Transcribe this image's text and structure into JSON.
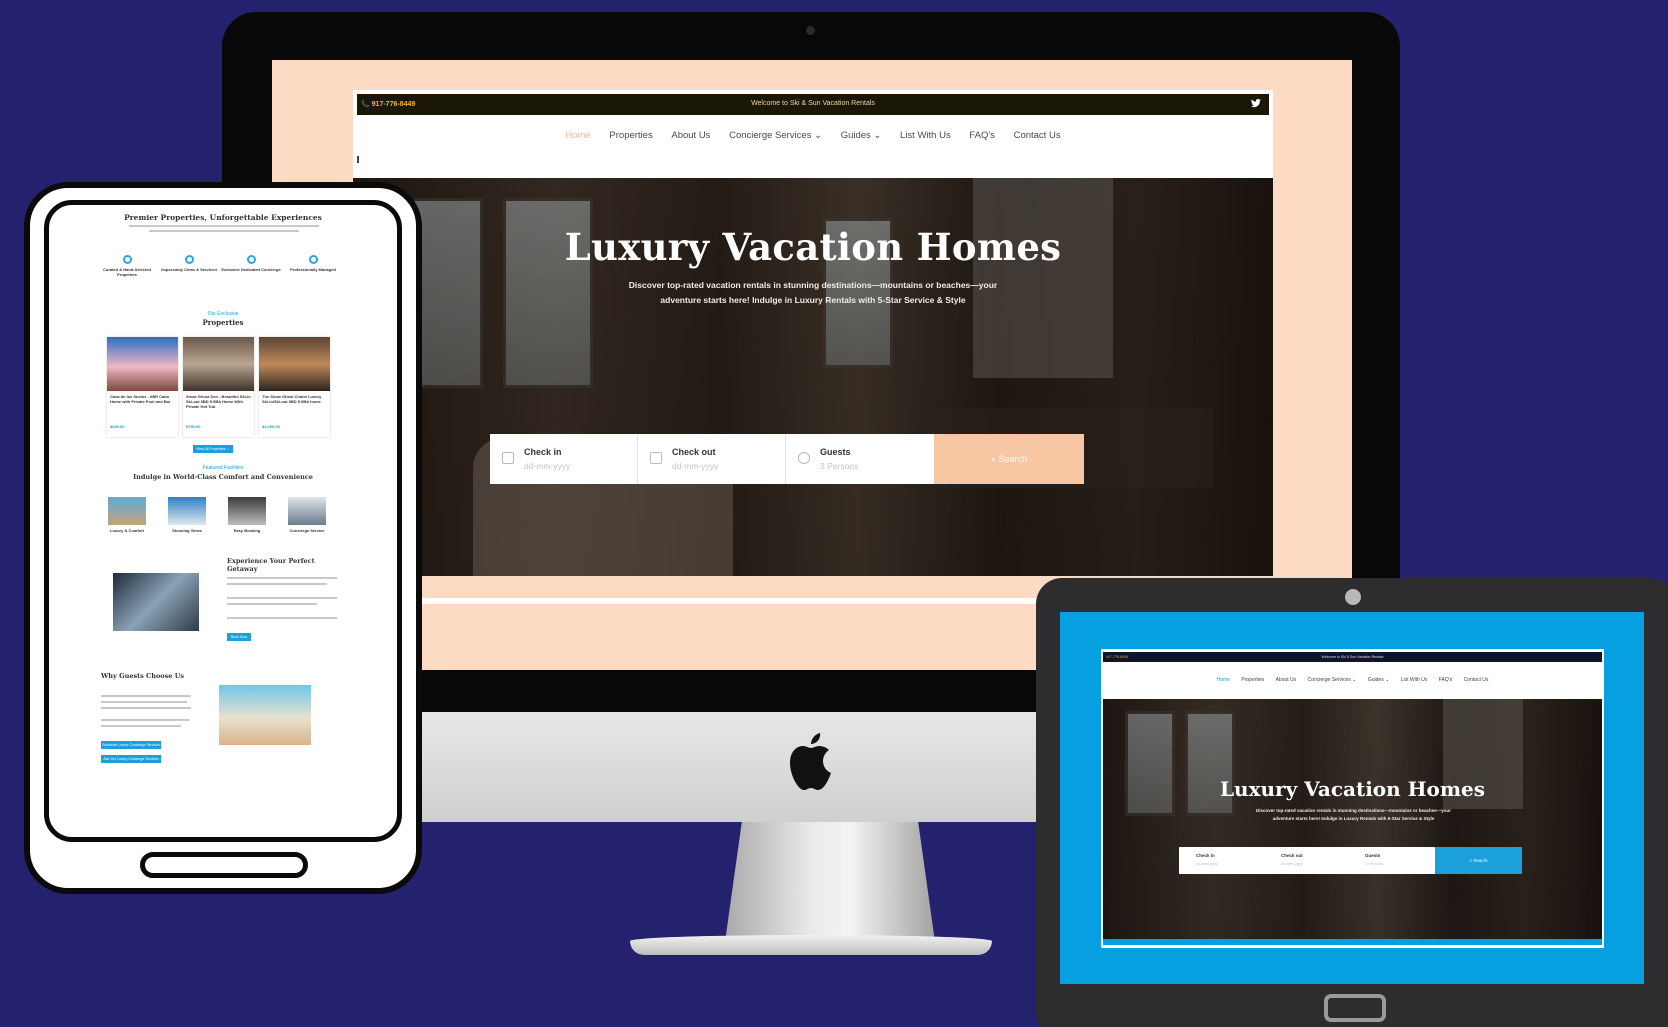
{
  "brand_colors": {
    "backdrop": "#24226e",
    "peach_accent": "#f7c7a4",
    "blue_accent": "#1ba0dc"
  },
  "desktop": {
    "phone": "📞 917-776-8449",
    "welcome": "Welcome to Ski & Sun Vacation Rentals",
    "twitter_icon": "twitter-icon",
    "nav": [
      "Home",
      "Properties",
      "About Us",
      "Concierge Services ⌄",
      "Guides ⌄",
      "List With Us",
      "FAQ's",
      "Contact Us"
    ],
    "hero_title": "Luxury Vacation Homes",
    "hero_subtitle": "Discover top-rated vacation rentals in stunning destinations—mountains or beaches—your adventure starts here! Indulge in Luxury Rentals with 5-Star Service & Style",
    "search": {
      "checkin_label": "Check in",
      "checkin_placeholder": "dd-mm-yyyy",
      "checkout_label": "Check out",
      "checkout_placeholder": "dd-mm-yyyy",
      "guests_label": "Guests",
      "guests_value": "3 Persons",
      "button": "⌕ Search"
    }
  },
  "tablet": {
    "intro_title": "Premier Properties, Unforgettable Experiences",
    "features": [
      "Curated & Hand-Selected Properties",
      "Impeccably Clean & Serviced",
      "Exclusive Dedicated Concierge",
      "Professionally Managed"
    ],
    "props_kicker": "Our Exclusive",
    "props_title": "Properties",
    "properties": [
      {
        "title": "Casa de los Suelos - 6BR Cabo Home with Private Pool and Bar",
        "price": "$600.00"
      },
      {
        "title": "Snow Ghost Den - Beautiful Ski-in Ski-out 5BD 5.5BA Home With Private Hot Tub",
        "price": "$750.00"
      },
      {
        "title": "The Snow Ghost Chalet Luxury Ski-in/Ski-out 5BD 5.5BA home",
        "price": "$2,000.00"
      }
    ],
    "view_all": "View All Properties →",
    "amenities_kicker": "Featured Facilities",
    "amenities_title": "Indulge in World-Class Comfort and Convenience",
    "amenities": [
      "Luxury & Comfort",
      "Stunning Views",
      "Easy Booking",
      "Concierge Service"
    ],
    "getaway_title": "Experience Your Perfect Getaway",
    "getaway_button": "Book Now",
    "why_title": "Why Guests Choose Us",
    "why_button_1": "Schedule Luxury Concierge Services",
    "why_button_2": "Ask Our Luxury Concierge Services"
  },
  "ipad": {
    "phone": "917-776-8449",
    "welcome": "Welcome to Ski & Sun Vacation Rentals",
    "nav": [
      "Home",
      "Properties",
      "About Us",
      "Concierge Services ⌄",
      "Guides ⌄",
      "List With Us",
      "FAQ's",
      "Contact Us"
    ],
    "hero_title": "Luxury Vacation Homes",
    "hero_subtitle": "Discover top-rated vacation rentals in stunning destinations—mountains or beaches—your adventure starts here! Indulge in Luxury Rentals with 5-Star Service & Style",
    "search": {
      "checkin_label": "Check in",
      "checkin_placeholder": "dd-mm-yyyy",
      "checkout_label": "Check out",
      "checkout_placeholder": "dd-mm-yyyy",
      "guests_label": "Guests",
      "guests_value": "3 Persons",
      "button": "⌕ Search"
    }
  }
}
